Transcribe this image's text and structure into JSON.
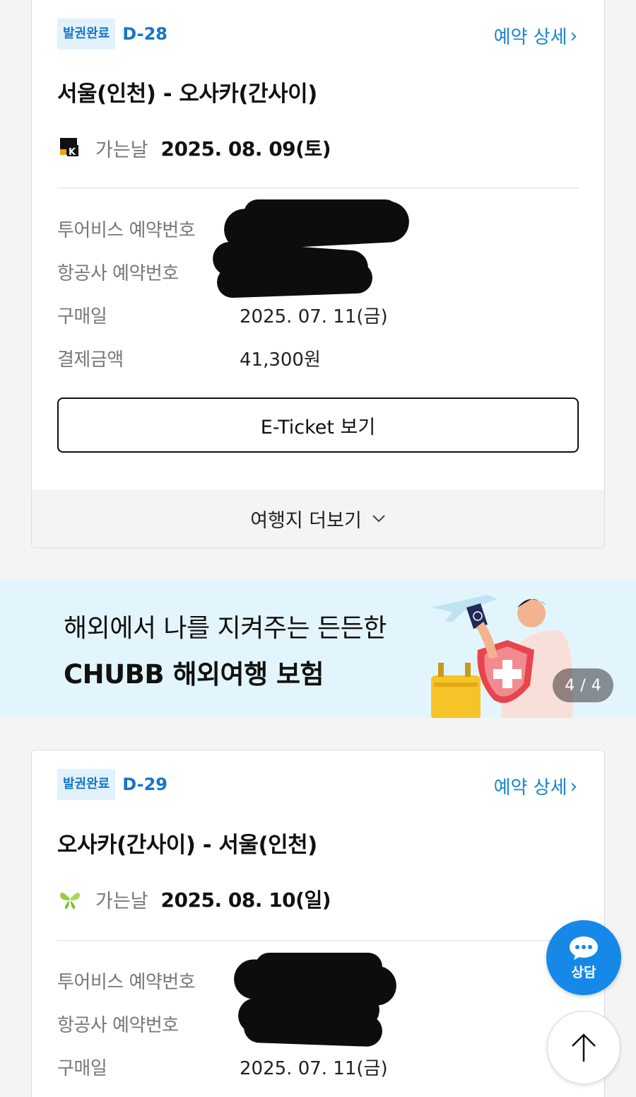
{
  "bookings": [
    {
      "badge": "발권완료",
      "dday": "D-28",
      "detail_link": "예약 상세",
      "route": "서울(인천) - 오사카(간사이)",
      "airline_logo": "k-airline-logo",
      "go_label": "가는날",
      "go_date": "2025. 08. 09(토)",
      "info": [
        {
          "label": "투어비스 예약번호",
          "value": ""
        },
        {
          "label": "항공사 예약번호",
          "value": ""
        },
        {
          "label": "구매일",
          "value": "2025. 07. 11(금)"
        },
        {
          "label": "결제금액",
          "value": "41,300원"
        }
      ],
      "eticket_button": "E-Ticket 보기",
      "more_button": "여행지 더보기"
    },
    {
      "badge": "발권완료",
      "dday": "D-29",
      "detail_link": "예약 상세",
      "route": "오사카(간사이) - 서울(인천)",
      "airline_logo": "butterfly-airline-logo",
      "go_label": "가는날",
      "go_date": "2025. 08. 10(일)",
      "info": [
        {
          "label": "투어비스 예약번호",
          "value": ""
        },
        {
          "label": "항공사 예약번호",
          "value": ""
        },
        {
          "label": "구매일",
          "value": "2025. 07. 11(금)"
        }
      ]
    }
  ],
  "banner": {
    "line1": "해외에서 나를 지켜주는 든든한",
    "line2": "CHUBB 해외여행 보험",
    "page_current": "4",
    "page_total": "4",
    "page_separator": "/"
  },
  "floating": {
    "chat_label": "상담",
    "top_icon": "arrow-up-icon"
  },
  "colors": {
    "accent": "#1476c8",
    "badge_bg": "#e2f2fc",
    "chat_bg": "#1689e8",
    "banner_bg": "#e3f5fc"
  }
}
